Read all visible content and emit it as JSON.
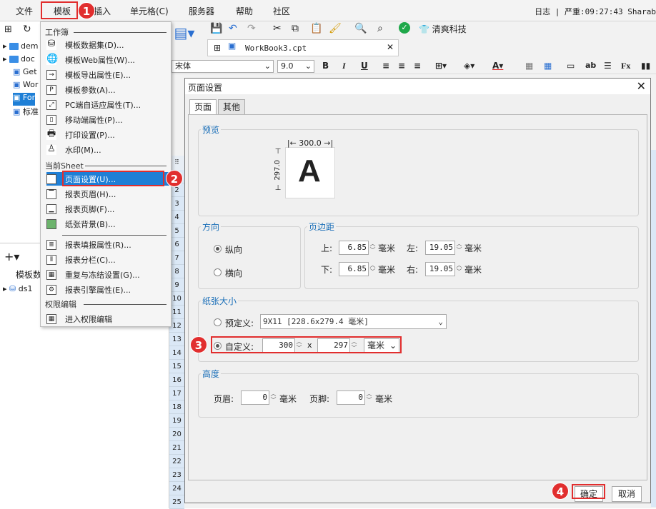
{
  "menubar": {
    "items": [
      "文件",
      "模板",
      "插入",
      "单元格(C)",
      "服务器",
      "帮助",
      "社区"
    ],
    "status": "日志 | 严重:09:27:43 Sharab"
  },
  "callouts": [
    "1",
    "2",
    "3",
    "4"
  ],
  "left_tree": {
    "rows": [
      "dem",
      "doc",
      "Get",
      "Wor",
      "For",
      "标准"
    ],
    "bottom_title": "模板数",
    "ds": "ds1"
  },
  "dropdown": {
    "sec_workbook": "工作簿",
    "workbook_items": [
      "模板数据集(D)...",
      "模板Web属性(W)...",
      "模板导出属性(E)...",
      "模板参数(A)...",
      "PC端自适应属性(T)...",
      "移动端属性(P)...",
      "打印设置(P)...",
      "水印(M)..."
    ],
    "sec_sheet": "当前Sheet",
    "sheet_items": [
      "页面设置(U)...",
      "报表页眉(H)...",
      "报表页脚(F)...",
      "纸张背景(B)..."
    ],
    "more_items": [
      "报表填报属性(R)...",
      "报表分栏(C)...",
      "重复与冻结设置(G)...",
      "报表引擎属性(E)..."
    ],
    "sec_auth": "权限编辑",
    "auth_items": [
      "进入权限编辑"
    ]
  },
  "toolbar": {
    "brand": "清爽科技"
  },
  "doc_tab": {
    "title": "WorkBook3.cpt"
  },
  "format_bar": {
    "font": "宋体",
    "size": "9.0"
  },
  "row_numbers": [
    "1",
    "2",
    "3",
    "4",
    "5",
    "6",
    "7",
    "8",
    "9",
    "10",
    "11",
    "12",
    "13",
    "14",
    "15",
    "16",
    "17",
    "18",
    "19",
    "20",
    "21",
    "22",
    "23",
    "24",
    "25"
  ],
  "dialog": {
    "title": "页面设置",
    "tabs": [
      "页面",
      "其他"
    ],
    "preview": {
      "label": "预览",
      "width": "300.0",
      "height": "297.0",
      "letter": "A"
    },
    "orientation": {
      "label": "方向",
      "portrait": "纵向",
      "landscape": "横向",
      "selected": "纵向"
    },
    "margin": {
      "label": "页边距",
      "top_label": "上:",
      "top": "6.85",
      "bottom_label": "下:",
      "bottom": "6.85",
      "left_label": "左:",
      "left": "19.05",
      "right_label": "右:",
      "right": "19.05",
      "unit": "毫米"
    },
    "paper": {
      "label": "纸张大小",
      "predefined_label": "预定义:",
      "predefined_value": "9X11 [228.6x279.4 毫米]",
      "custom_label": "自定义:",
      "custom_width": "300",
      "x": "x",
      "custom_height": "297",
      "unit": "毫米",
      "selected": "自定义"
    },
    "height": {
      "label": "高度",
      "header_label": "页眉:",
      "header": "0",
      "footer_label": "页脚:",
      "footer": "0",
      "unit": "毫米"
    },
    "ok": "确定",
    "cancel": "取消"
  }
}
